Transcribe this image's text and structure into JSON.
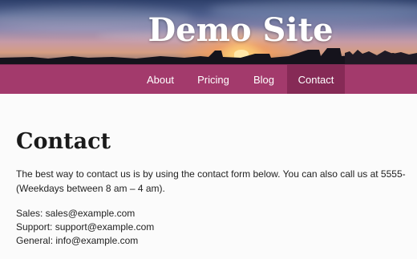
{
  "site": {
    "title": "Demo Site"
  },
  "nav": {
    "items": [
      {
        "label": "About"
      },
      {
        "label": "Pricing"
      },
      {
        "label": "Blog"
      },
      {
        "label": "Contact",
        "active": true
      }
    ],
    "bg_color": "#a33a6c",
    "active_color": "#862a56"
  },
  "page": {
    "heading": "Contact",
    "intro_line1": "The best way to contact us is by using the contact form below. You can also call us at 5555-",
    "intro_line2": "(Weekdays between 8 am – 4 am).",
    "contacts": [
      {
        "text": "Sales: sales@example.com"
      },
      {
        "text": "Support: support@example.com"
      },
      {
        "text": "General: info@example.com"
      }
    ]
  }
}
